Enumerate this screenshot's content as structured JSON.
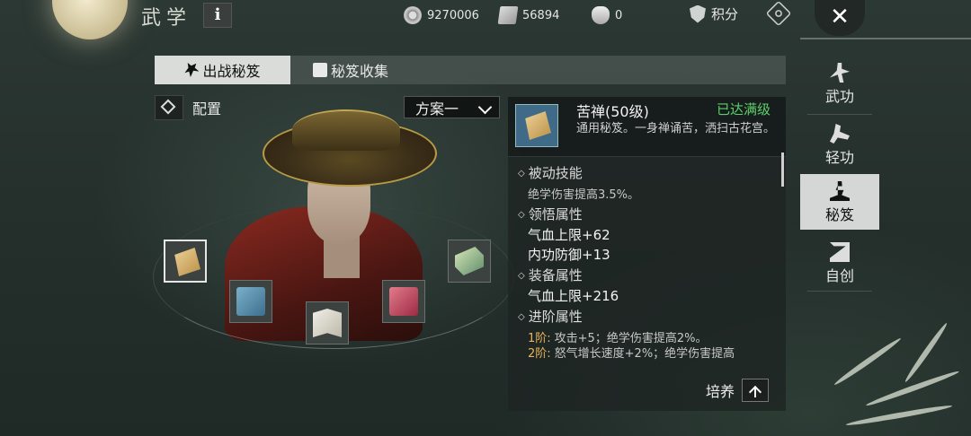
{
  "header": {
    "title": "武学",
    "info_label": "i",
    "currencies": [
      {
        "icon": "coin-icon",
        "value": "9270006"
      },
      {
        "icon": "ticket-icon",
        "value": "56894"
      },
      {
        "icon": "sack-icon",
        "value": "0"
      }
    ],
    "points_label": "积分",
    "close_label": "✕"
  },
  "tabs": [
    {
      "label": "出战秘笈",
      "active": true,
      "icon": "fighter-icon"
    },
    {
      "label": "秘笈收集",
      "active": false,
      "icon": "book-icon"
    }
  ],
  "config": {
    "label": "配置",
    "scheme_selected": "方案一"
  },
  "slots": [
    {
      "icon": "golden-scroll-icon",
      "selected": true
    },
    {
      "icon": "blue-book-icon",
      "selected": false
    },
    {
      "icon": "open-book-icon",
      "selected": false
    },
    {
      "icon": "red-book-icon",
      "selected": false
    },
    {
      "icon": "green-scroll-icon",
      "selected": false
    }
  ],
  "detail": {
    "name": "苦禅(50级)",
    "max_label": "已达满级",
    "desc": "通用秘笈。一身禅诵苦，洒扫古花宫。",
    "passive_title": "被动技能",
    "passive_text": "绝学伤害提高3.5%。",
    "comprehend_title": "领悟属性",
    "comprehend_stats": [
      "气血上限+62",
      "内功防御+13"
    ],
    "equip_title": "装备属性",
    "equip_stats": [
      "气血上限+216"
    ],
    "advance_title": "进阶属性",
    "advances": [
      {
        "level": "1阶:",
        "text": "攻击+5；绝学伤害提高2%。"
      },
      {
        "level": "2阶:",
        "text": "怒气增长速度+2%；绝学伤害提高"
      }
    ],
    "train_label": "培养"
  },
  "side_nav": [
    {
      "label": "武功",
      "icon": "martial-arts-icon",
      "active": false
    },
    {
      "label": "轻功",
      "icon": "lightness-skill-icon",
      "active": false
    },
    {
      "label": "秘笈",
      "icon": "meditation-icon",
      "active": true
    },
    {
      "label": "自创",
      "icon": "self-create-icon",
      "active": false
    }
  ],
  "colors": {
    "max_level": "#5ed06a",
    "advance_level": "#e8b45b",
    "active_tab": "#d9dcd9"
  }
}
